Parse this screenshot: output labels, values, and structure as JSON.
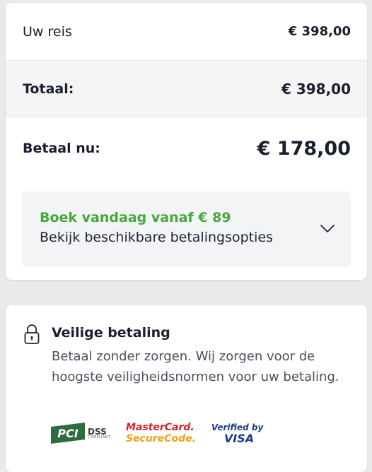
{
  "summary": {
    "trip_label": "Uw reis",
    "trip_value": "€ 398,00",
    "total_label": "Totaal:",
    "total_value": "€ 398,00",
    "paynow_label": "Betaal nu:",
    "paynow_value": "€ 178,00"
  },
  "payment_options": {
    "headline": "Boek vandaag vanaf € 89",
    "subtext": "Bekijk beschikbare betalingsopties",
    "headline_color": "#46a83b",
    "toggle_icon": "chevron-down-icon"
  },
  "secure": {
    "icon": "lock-icon",
    "title": "Veilige betaling",
    "text": "Betaal zonder zorgen. Wij zorgen voor de hoogste veiligheidsnormen voor uw betaling.",
    "logos": {
      "pci_mark": "PCI",
      "pci_dss": "DSS",
      "pci_compliant": "COMPLIANT",
      "mastercard_line1": "MasterCard.",
      "mastercard_line2": "SecureCode.",
      "visa_line1": "Verified by",
      "visa_line2": "VISA"
    }
  }
}
